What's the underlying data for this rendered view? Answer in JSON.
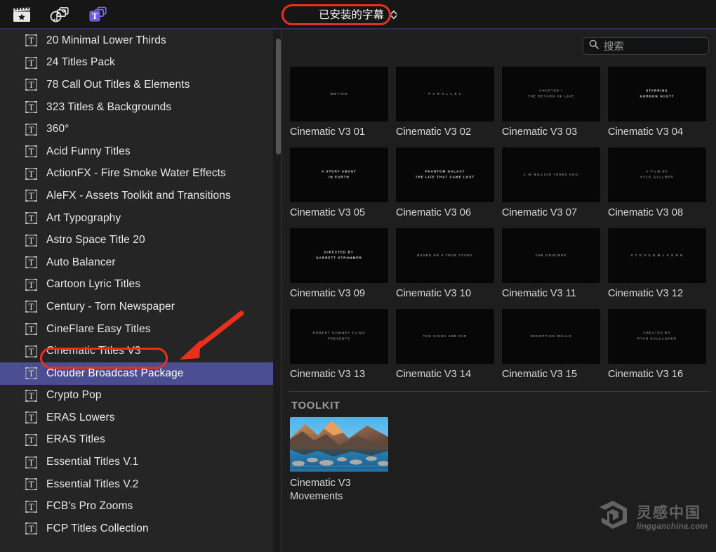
{
  "toolbar": {
    "icons": [
      {
        "name": "video-effects-icon",
        "label": "影片"
      },
      {
        "name": "audio-photos-icon",
        "label": "音乐与照片"
      },
      {
        "name": "titles-icon",
        "label": "字幕"
      }
    ],
    "popup": {
      "label": "已安装的字幕",
      "chevron": "chevron-up-down"
    },
    "accent_color": "#2f2c63",
    "annotation_color": "#e8301b"
  },
  "sidebar": {
    "selected_index": 15,
    "selected_color": "#4a4d8f",
    "items": [
      {
        "label": "20 Minimal Lower Thirds"
      },
      {
        "label": "24 Titles Pack"
      },
      {
        "label": "78 Call Out Titles & Elements"
      },
      {
        "label": "323 Titles & Backgrounds"
      },
      {
        "label": "360°"
      },
      {
        "label": "Acid Funny Titles"
      },
      {
        "label": "ActionFX - Fire Smoke Water Effects"
      },
      {
        "label": "AleFX - Assets Toolkit and Transitions"
      },
      {
        "label": "Art Typography"
      },
      {
        "label": "Astro Space Title 20"
      },
      {
        "label": "Auto Balancer"
      },
      {
        "label": "Cartoon Lyric Titles"
      },
      {
        "label": "Century - Torn Newspaper"
      },
      {
        "label": "CineFlare Easy Titles"
      },
      {
        "label": "Cinematic Titles V3"
      },
      {
        "label": "Clouder Broadcast Package"
      },
      {
        "label": "Crypto Pop"
      },
      {
        "label": "ERAS Lowers"
      },
      {
        "label": "ERAS Titles"
      },
      {
        "label": "Essential Titles V.1"
      },
      {
        "label": "Essential Titles V.2"
      },
      {
        "label": "FCB's Pro Zooms"
      },
      {
        "label": "FCP Titles Collection"
      }
    ]
  },
  "search": {
    "placeholder": "搜索",
    "value": "",
    "icon": "search-icon"
  },
  "main": {
    "items": [
      {
        "label": "Cinematic V3 01",
        "preview": "MOTION",
        "bright": false
      },
      {
        "label": "Cinematic V3 02",
        "preview": "P A R A L L E L",
        "bright": false
      },
      {
        "label": "Cinematic V3 03",
        "preview": "CHAPTER  I\nTHE RETURN OF LIFE",
        "bright": false
      },
      {
        "label": "Cinematic V3 04",
        "preview": "STARRING\nGORDON SCOTT",
        "bright": true
      },
      {
        "label": "Cinematic V3 05",
        "preview": "A STORY ABOUT\nIN EARTH",
        "bright": true
      },
      {
        "label": "Cinematic V3 06",
        "preview": "PHANTOM GALAXY\nTHE LIFE THAT CAME LOST",
        "bright": true
      },
      {
        "label": "Cinematic V3 07",
        "preview": "1 IN BILLION YEARS AGO",
        "bright": false
      },
      {
        "label": "Cinematic V3 08",
        "preview": "A FILM BY\nKYLE GALLNER",
        "bright": false
      },
      {
        "label": "Cinematic V3 09",
        "preview": "DIRECTED BY\nGARRETT STROMMER",
        "bright": true
      },
      {
        "label": "Cinematic V3 10",
        "preview": "BASED ON A TRUE STORY",
        "bright": false
      },
      {
        "label": "Cinematic V3 11",
        "preview": "THE ORIGINES",
        "bright": false
      },
      {
        "label": "Cinematic V3 12",
        "preview": "S T E V E N   M c K E N N",
        "bright": false
      },
      {
        "label": "Cinematic V3 13",
        "preview": "ROBERT DOWNEY FILMS\nPRESENTS",
        "bright": false
      },
      {
        "label": "Cinematic V3 14",
        "preview": "THE SIGNS ARE FAR",
        "bright": false
      },
      {
        "label": "Cinematic V3 15",
        "preview": "DECEPTION WELLS",
        "bright": false
      },
      {
        "label": "Cinematic V3 16",
        "preview": "CREATED BY\nRYAN GALLAGHER",
        "bright": false
      }
    ],
    "toolkit": {
      "title": "TOOLKIT",
      "items": [
        {
          "label": "Cinematic V3\nMovements",
          "thumbnail": "mountain-lake-photo"
        }
      ]
    }
  },
  "watermark": {
    "cn": "灵感中国",
    "en": "lingganchina.com",
    "logo": "lingganchina-logo"
  }
}
